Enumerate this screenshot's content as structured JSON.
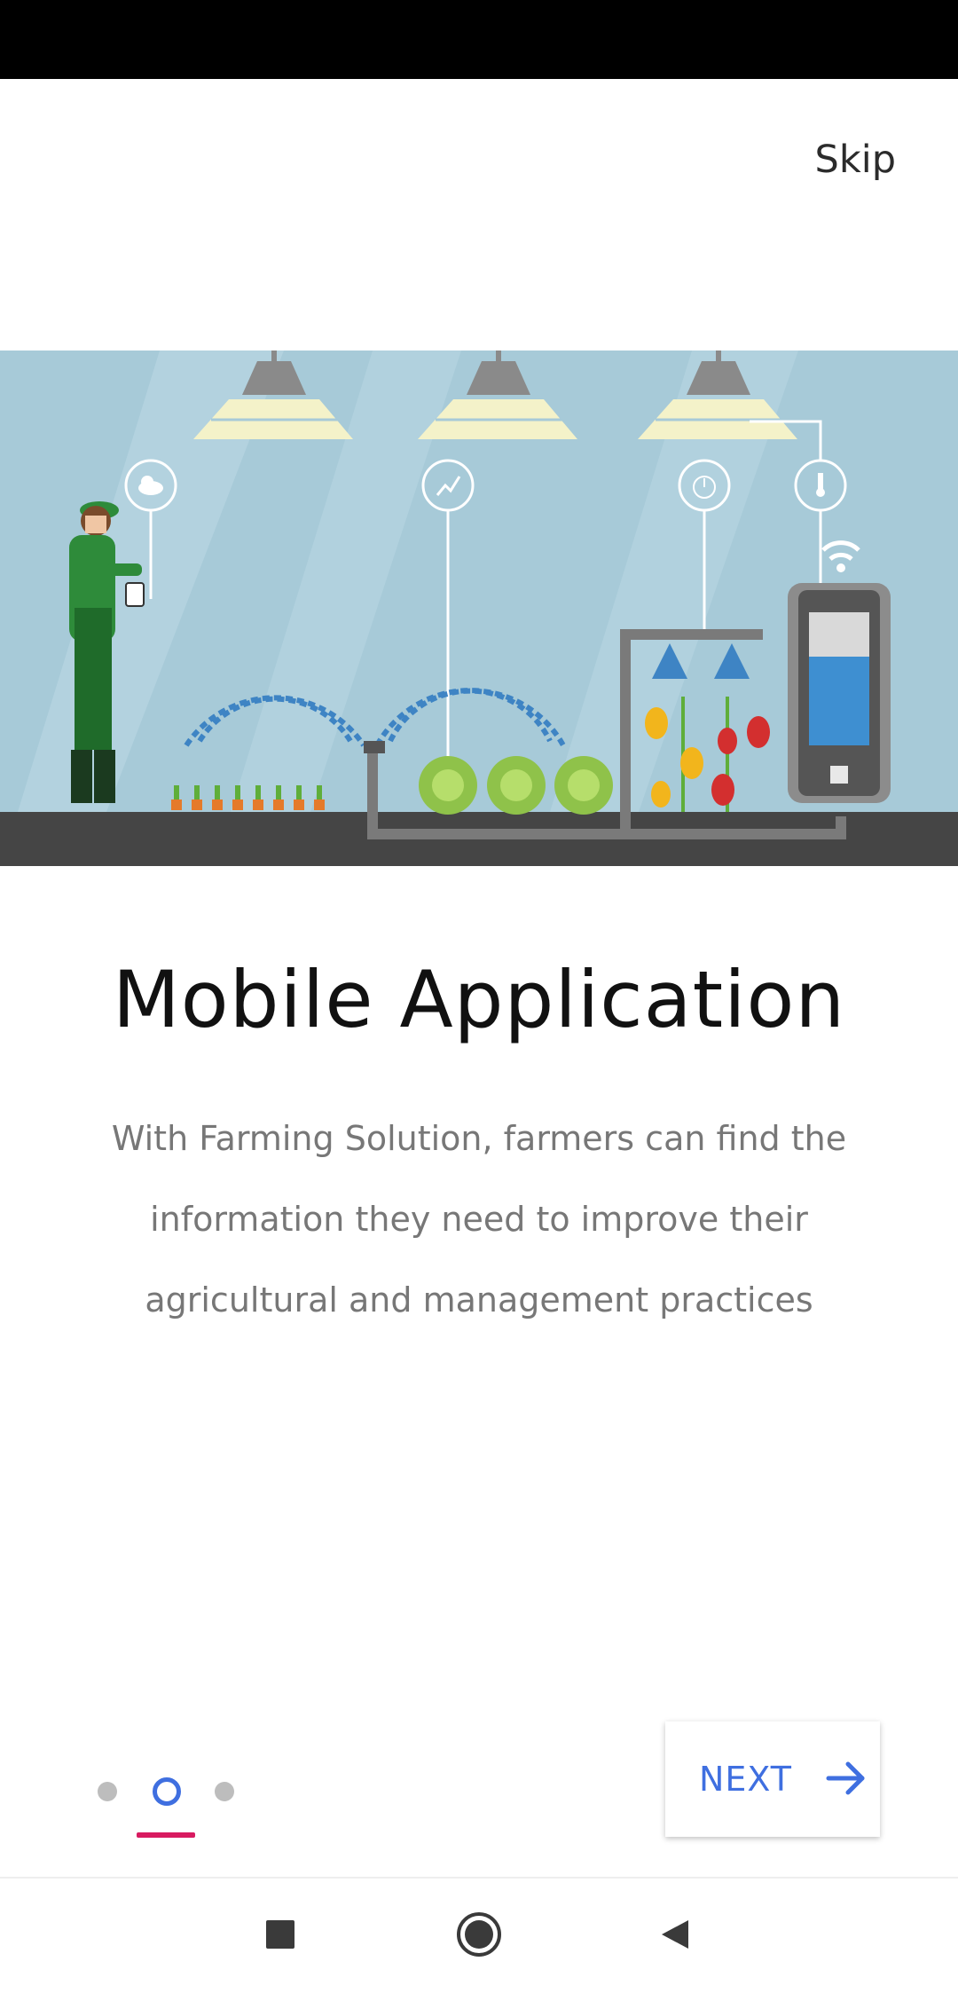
{
  "header": {
    "skip_label": "Skip"
  },
  "hero": {
    "illustration": "smart-farm-illustration"
  },
  "onboarding": {
    "title": "Mobile Application",
    "description": "With Farming Solution, farmers can find the information they need to improve their agricultural and management practices",
    "page_indicator": {
      "total": 3,
      "active_index": 1
    }
  },
  "actions": {
    "next_label": "NEXT",
    "next_icon": "arrow-right-icon"
  },
  "system_nav": {
    "recents_icon": "square-icon",
    "home_icon": "circle-home-icon",
    "back_icon": "triangle-back-icon"
  },
  "colors": {
    "accent_blue": "#3f6fe0",
    "indicator_pink": "#d81b60",
    "hero_background": "#a7cad8"
  }
}
